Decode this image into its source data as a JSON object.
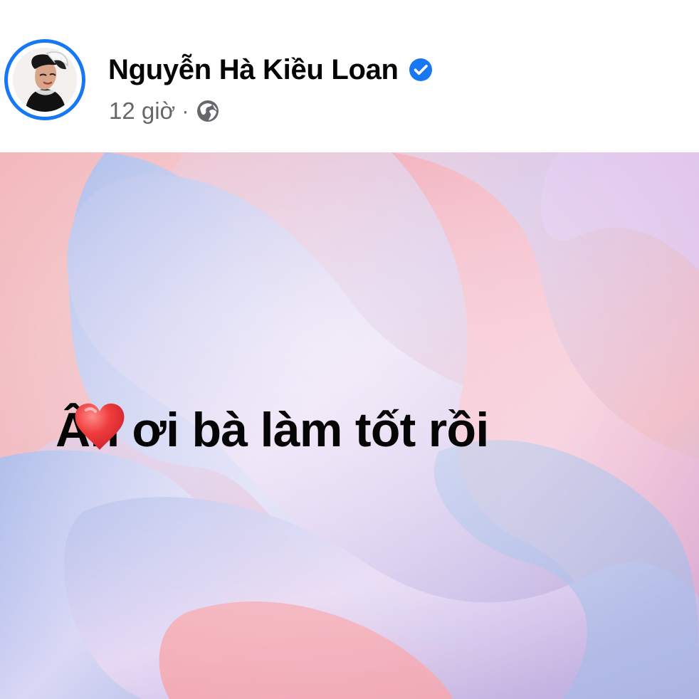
{
  "post": {
    "author_name": "Nguyễn Hà Kiều Loan",
    "timestamp": "12 giờ",
    "separator": "·",
    "message": "Ân ơi bà làm tốt rồi"
  },
  "icons": {
    "verified": "verified-badge-icon",
    "audience": "globe-icon",
    "message_emoji": "red-heart-icon"
  },
  "colors": {
    "facebook_blue": "#1877f2",
    "heart_red": "#e93f3f",
    "background_pink": "#f2b4bb",
    "background_lavender": "#d9c7ea",
    "background_blue": "#a8b8e4",
    "text": "#050505",
    "secondary_text": "#65676b"
  }
}
